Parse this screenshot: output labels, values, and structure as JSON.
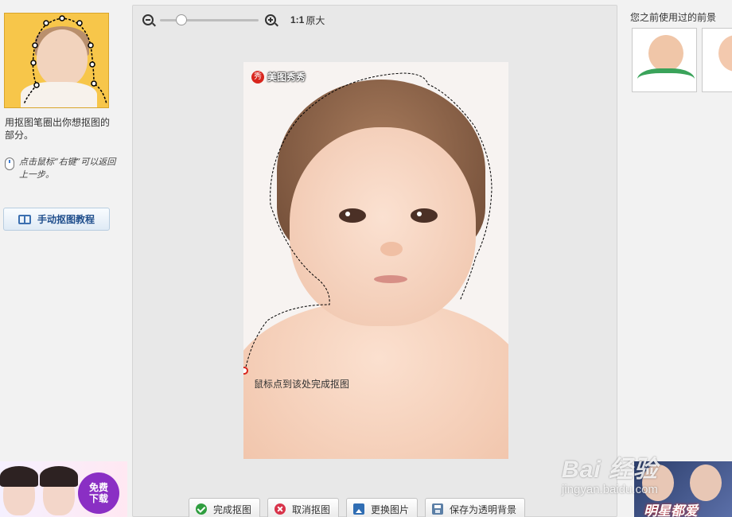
{
  "left_panel": {
    "instruction": "用抠图笔圈出你想抠图的部分。",
    "tip": "点击鼠标“右键”可以返回上一步。",
    "tutorial_button": "手动抠图教程",
    "ad_badge": [
      "免费",
      "下载"
    ]
  },
  "zoom_bar": {
    "ratio_label": "1:1",
    "original_label": "原大",
    "zoom_level": 0.18
  },
  "canvas": {
    "watermark": "美图秀秀",
    "watermark_logo": "秀",
    "finish_hint": "鼠标点到该处完成抠图"
  },
  "actions": {
    "complete": "完成抠图",
    "cancel": "取消抠图",
    "change_image": "更换图片",
    "save_transparent": "保存为透明背景"
  },
  "right_panel": {
    "title": "您之前使用过的前景",
    "ad_text": "明星都爱"
  },
  "watermark_brand": {
    "brand": "Bai  经验",
    "url": "jingyan.baidu.com"
  },
  "colors": {
    "accent_blue": "#1f4e8c",
    "mark_red": "#d8251d",
    "check_green": "#2f9e3f"
  }
}
